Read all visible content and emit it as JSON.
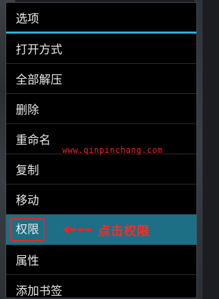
{
  "dialog": {
    "title": "选项",
    "items": [
      {
        "label": "打开方式"
      },
      {
        "label": "全部解压"
      },
      {
        "label": "删除"
      },
      {
        "label": "重命名"
      },
      {
        "label": "复制"
      },
      {
        "label": "移动"
      },
      {
        "label": "权限",
        "highlighted": true
      },
      {
        "label": "属性"
      },
      {
        "label": "添加书签"
      }
    ]
  },
  "annotation": {
    "text": "点击权限"
  },
  "watermark": {
    "text": "www.qinpinchang.com"
  },
  "colors": {
    "accent_line": "#27b4d8",
    "highlight_row": "#1d6f85",
    "annotation_red": "#ff2a23"
  }
}
